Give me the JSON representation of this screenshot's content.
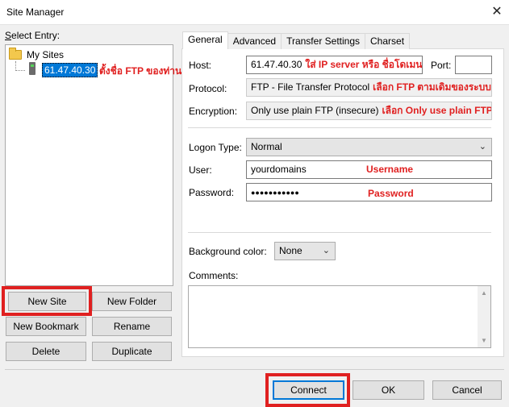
{
  "window": {
    "title": "Site Manager",
    "close_glyph": "✕"
  },
  "left": {
    "select_entry_label": "Select Entry:",
    "tree": {
      "root_label": "My Sites",
      "items": [
        {
          "label": "61.47.40.30",
          "annotation": "ตั้งชื่อ FTP ของท่าน"
        }
      ]
    },
    "buttons": {
      "new_site": "New Site",
      "new_folder": "New Folder",
      "new_bookmark": "New Bookmark",
      "rename": "Rename",
      "delete": "Delete",
      "duplicate": "Duplicate"
    }
  },
  "tabs": [
    "General",
    "Advanced",
    "Transfer Settings",
    "Charset"
  ],
  "general": {
    "host_label": "Host:",
    "host_value": "61.47.40.30",
    "host_annotation": "ใส่ IP server หรือ ชื่อโดเมนของท่าน",
    "port_label": "Port:",
    "port_value": "",
    "protocol_label": "Protocol:",
    "protocol_value": "FTP - File Transfer Protocol",
    "protocol_annotation": "เลือก FTP ตามเดิมของระบบ",
    "encryption_label": "Encryption:",
    "encryption_value": "Only use plain FTP (insecure)",
    "encryption_annotation": "เลือก Only use plain FTP",
    "logon_type_label": "Logon Type:",
    "logon_type_value": "Normal",
    "user_label": "User:",
    "user_value": "yourdomains",
    "user_annotation": "Username",
    "password_label": "Password:",
    "password_value": "●●●●●●●●●●●",
    "password_annotation": "Password",
    "bg_color_label": "Background color:",
    "bg_color_value": "None",
    "comments_label": "Comments:",
    "comments_value": ""
  },
  "footer": {
    "connect": "Connect",
    "ok": "OK",
    "cancel": "Cancel"
  },
  "colors": {
    "highlight": "#e02020",
    "selection": "#0078d7"
  }
}
